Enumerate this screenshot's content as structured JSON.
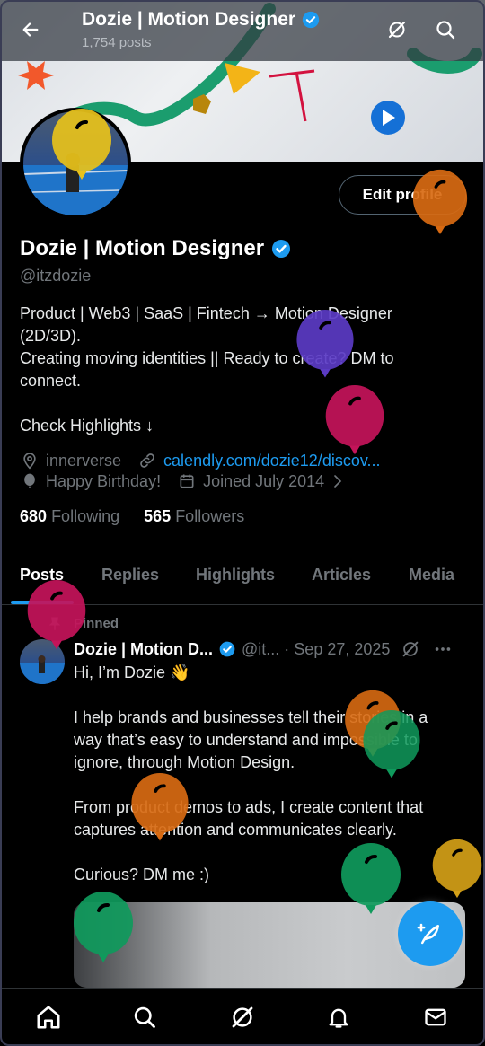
{
  "header": {
    "title": "Dozie | Motion Designer",
    "post_count": "1,754 posts"
  },
  "profile": {
    "edit_button": "Edit profile",
    "name": "Dozie | Motion Designer",
    "handle": "@itzdozie",
    "bio": [
      "Product | Web3 | SaaS | Fintech → Motion Designer",
      "(2D/3D).",
      "Creating moving identities || Ready to create? DM to",
      "connect.",
      "",
      "Check Highlights ↓"
    ],
    "location": "innerverse",
    "website": "calendly.com/dozie12/discov...",
    "birthday": "Happy Birthday!",
    "joined": "Joined July 2014",
    "following_count": "680",
    "following_label": "Following",
    "followers_count": "565",
    "followers_label": "Followers"
  },
  "tabs": [
    "Posts",
    "Replies",
    "Highlights",
    "Articles",
    "Media"
  ],
  "post": {
    "pinned_label": "Pinned",
    "author_name": "Dozie | Motion D...",
    "author_handle_date": "@it... · Sep 27, 2025",
    "lines": [
      "Hi, I’m Dozie 👋",
      "",
      "I help brands and businesses tell their stories in a",
      "way that’s easy to understand and impossible to",
      "ignore, through Motion Design.",
      "",
      "From product demos to ads, I create content that",
      "captures attention and communicates clearly.",
      "",
      "Curious? DM me :)"
    ]
  },
  "icons": {
    "back": "back-arrow-icon",
    "grok": "grok-icon",
    "search": "search-icon",
    "verified": "verified-badge-icon",
    "location": "location-pin-icon",
    "link": "link-icon",
    "birthday": "balloon-icon",
    "calendar": "calendar-icon",
    "pin": "pin-icon",
    "more": "more-icon",
    "compose": "compose-icon",
    "home": "home-icon",
    "notifications": "bell-icon",
    "messages": "mail-icon"
  },
  "colors": {
    "accent": "#1d9bf0",
    "background": "#000000",
    "muted": "#71767b",
    "balloons": [
      "#e8c21a",
      "#d86a12",
      "#5b3bc4",
      "#c4145a",
      "#0f9a5c",
      "#d4a017"
    ]
  }
}
